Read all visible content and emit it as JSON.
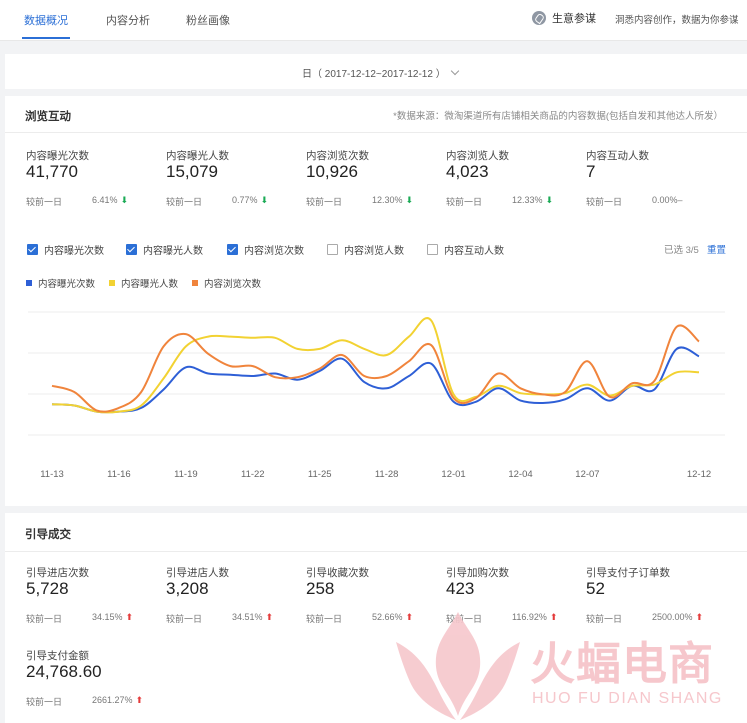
{
  "nav": {
    "tabs": [
      "数据概况",
      "内容分析",
      "粉丝画像"
    ],
    "biz_label": "生意参谋",
    "biz_desc": "洞悉内容创作，数据为你参谋"
  },
  "date_filter": {
    "label": "日（ 2017-12-12~2017-12-12 ）"
  },
  "browse": {
    "title": "浏览互动",
    "source": "*数据来源：微淘渠道所有店铺相关商品的内容数据(包括自发和其他达人所发）",
    "compare_label": "较前一日",
    "metrics": [
      {
        "label": "内容曝光次数",
        "value": "41,770",
        "pct": "6.41%",
        "trend": "down"
      },
      {
        "label": "内容曝光人数",
        "value": "15,079",
        "pct": "0.77%",
        "trend": "down"
      },
      {
        "label": "内容浏览次数",
        "value": "10,926",
        "pct": "12.30%",
        "trend": "down"
      },
      {
        "label": "内容浏览人数",
        "value": "4,023",
        "pct": "12.33%",
        "trend": "down"
      },
      {
        "label": "内容互动人数",
        "value": "7",
        "pct": "0.00%",
        "trend": "flat"
      }
    ],
    "checkboxes": [
      {
        "label": "内容曝光次数",
        "checked": true
      },
      {
        "label": "内容曝光人数",
        "checked": true
      },
      {
        "label": "内容浏览次数",
        "checked": true
      },
      {
        "label": "内容浏览人数",
        "checked": false
      },
      {
        "label": "内容互动人数",
        "checked": false
      }
    ],
    "selected": "已选 3/5",
    "reset": "重置"
  },
  "chart_data": {
    "type": "line",
    "x": [
      "11-13",
      "11-14",
      "11-15",
      "11-16",
      "11-17",
      "11-18",
      "11-19",
      "11-20",
      "11-21",
      "11-22",
      "11-23",
      "11-24",
      "11-25",
      "11-26",
      "11-27",
      "11-28",
      "11-29",
      "11-30",
      "12-01",
      "12-02",
      "12-03",
      "12-04",
      "12-05",
      "12-06",
      "12-07",
      "12-08",
      "12-09",
      "12-10",
      "12-11",
      "12-12"
    ],
    "x_ticks": [
      "11-13",
      "11-16",
      "11-19",
      "11-22",
      "11-25",
      "11-28",
      "12-01",
      "12-04",
      "12-07",
      "12-12"
    ],
    "ylim": [
      0,
      100
    ],
    "grid": true,
    "legend_position": "top-left",
    "series": [
      {
        "name": "内容曝光次数",
        "color": "#2e5fd6",
        "values": [
          25,
          24,
          19,
          19,
          22,
          37,
          55,
          50,
          49,
          48,
          50,
          45,
          52,
          62,
          43,
          38,
          48,
          58,
          27,
          27,
          38,
          28,
          26,
          29,
          38,
          28,
          40,
          37,
          70,
          64
        ]
      },
      {
        "name": "内容曝光人数",
        "color": "#f2d232",
        "values": [
          25,
          24,
          19,
          19,
          24,
          46,
          72,
          80,
          80,
          79,
          79,
          70,
          70,
          77,
          70,
          65,
          80,
          93,
          33,
          31,
          40,
          34,
          33,
          34,
          41,
          32,
          40,
          41,
          51,
          51
        ]
      },
      {
        "name": "内容浏览次数",
        "color": "#f0843c",
        "values": [
          40,
          35,
          20,
          22,
          35,
          72,
          82,
          66,
          56,
          56,
          47,
          47,
          54,
          65,
          48,
          48,
          60,
          73,
          30,
          30,
          50,
          38,
          33,
          35,
          60,
          31,
          42,
          44,
          88,
          76
        ]
      }
    ]
  },
  "guide": {
    "title": "引导成交",
    "compare_label": "较前一日",
    "metrics": [
      {
        "label": "引导进店次数",
        "value": "5,728",
        "pct": "34.15%",
        "trend": "up"
      },
      {
        "label": "引导进店人数",
        "value": "3,208",
        "pct": "34.51%",
        "trend": "up"
      },
      {
        "label": "引导收藏次数",
        "value": "258",
        "pct": "52.66%",
        "trend": "up"
      },
      {
        "label": "引导加购次数",
        "value": "423",
        "pct": "116.92%",
        "trend": "up"
      },
      {
        "label": "引导支付子订单数",
        "value": "52",
        "pct": "2500.00%",
        "trend": "up"
      },
      {
        "label": "引导支付金额",
        "value": "24,768.60",
        "pct": "2661.27%",
        "trend": "up"
      }
    ]
  },
  "watermark": {
    "brand": "火蝠电商",
    "sub": "HUO FU DIAN SHANG"
  }
}
